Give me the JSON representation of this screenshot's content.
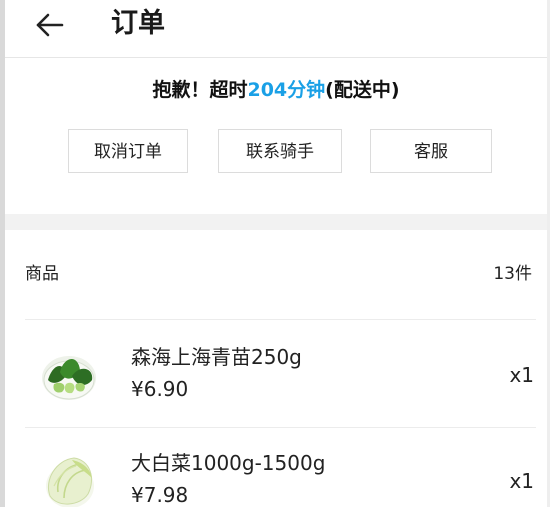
{
  "header": {
    "title": "订单",
    "back_icon": "arrow-left-icon"
  },
  "status": {
    "prefix": "抱歉！超时",
    "highlight": "204分钟",
    "suffix": "(配送中)",
    "highlight_color": "#1aa0e6"
  },
  "actions": {
    "cancel_label": "取消订单",
    "contact_label": "联系骑手",
    "service_label": "客服"
  },
  "goods": {
    "label": "商品",
    "count": "13件",
    "items": [
      {
        "name": "森海上海青苗250g",
        "price": "¥6.90",
        "qty": "x1",
        "icon": "bok-choy-icon"
      },
      {
        "name": "大白菜1000g-1500g",
        "price": "¥7.98",
        "qty": "x1",
        "icon": "napa-cabbage-icon"
      }
    ]
  }
}
